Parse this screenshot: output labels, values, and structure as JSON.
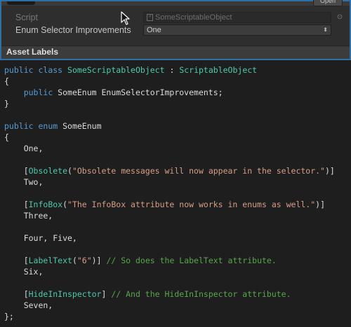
{
  "inspector": {
    "open_label": "Open",
    "script_label": "Script",
    "script_value": "SomeScriptableObject",
    "enum_label": "Enum Selector Improvements",
    "enum_value": "One",
    "asset_labels": "Asset Labels"
  },
  "code": {
    "lines": [
      [
        [
          "kw",
          "public"
        ],
        [
          "plain",
          " "
        ],
        [
          "kw",
          "class"
        ],
        [
          "plain",
          " "
        ],
        [
          "typ",
          "SomeScriptableObject"
        ],
        [
          "plain",
          " : "
        ],
        [
          "typ",
          "ScriptableObject"
        ]
      ],
      [
        [
          "plain",
          "{"
        ]
      ],
      [
        [
          "plain",
          "    "
        ],
        [
          "kw",
          "public"
        ],
        [
          "plain",
          " SomeEnum EnumSelectorImprovements;"
        ]
      ],
      [
        [
          "plain",
          "}"
        ]
      ],
      [],
      [
        [
          "kw",
          "public"
        ],
        [
          "plain",
          " "
        ],
        [
          "kw",
          "enum"
        ],
        [
          "plain",
          " SomeEnum"
        ]
      ],
      [
        [
          "plain",
          "{"
        ]
      ],
      [
        [
          "plain",
          "    One,"
        ]
      ],
      [],
      [
        [
          "plain",
          "    ["
        ],
        [
          "typ",
          "Obsolete"
        ],
        [
          "plain",
          "("
        ],
        [
          "str",
          "\"Obsolete messages will now appear in the selector.\""
        ],
        [
          "plain",
          ")]"
        ]
      ],
      [
        [
          "plain",
          "    Two,"
        ]
      ],
      [],
      [
        [
          "plain",
          "    ["
        ],
        [
          "typ",
          "InfoBox"
        ],
        [
          "plain",
          "("
        ],
        [
          "str",
          "\"The InfoBox attribute now works in enums as well.\""
        ],
        [
          "plain",
          ")]"
        ]
      ],
      [
        [
          "plain",
          "    Three,"
        ]
      ],
      [],
      [
        [
          "plain",
          "    Four, Five,"
        ]
      ],
      [],
      [
        [
          "plain",
          "    ["
        ],
        [
          "typ",
          "LabelText"
        ],
        [
          "plain",
          "("
        ],
        [
          "str",
          "\"6\""
        ],
        [
          "plain",
          ")] "
        ],
        [
          "com",
          "// So does the LabelText attribute."
        ]
      ],
      [
        [
          "plain",
          "    Six,"
        ]
      ],
      [],
      [
        [
          "plain",
          "    ["
        ],
        [
          "typ",
          "HideInInspector"
        ],
        [
          "plain",
          "] "
        ],
        [
          "com",
          "// And the HideInInspector attribute."
        ]
      ],
      [
        [
          "plain",
          "    Seven,"
        ]
      ],
      [
        [
          "plain",
          "};"
        ]
      ]
    ]
  }
}
